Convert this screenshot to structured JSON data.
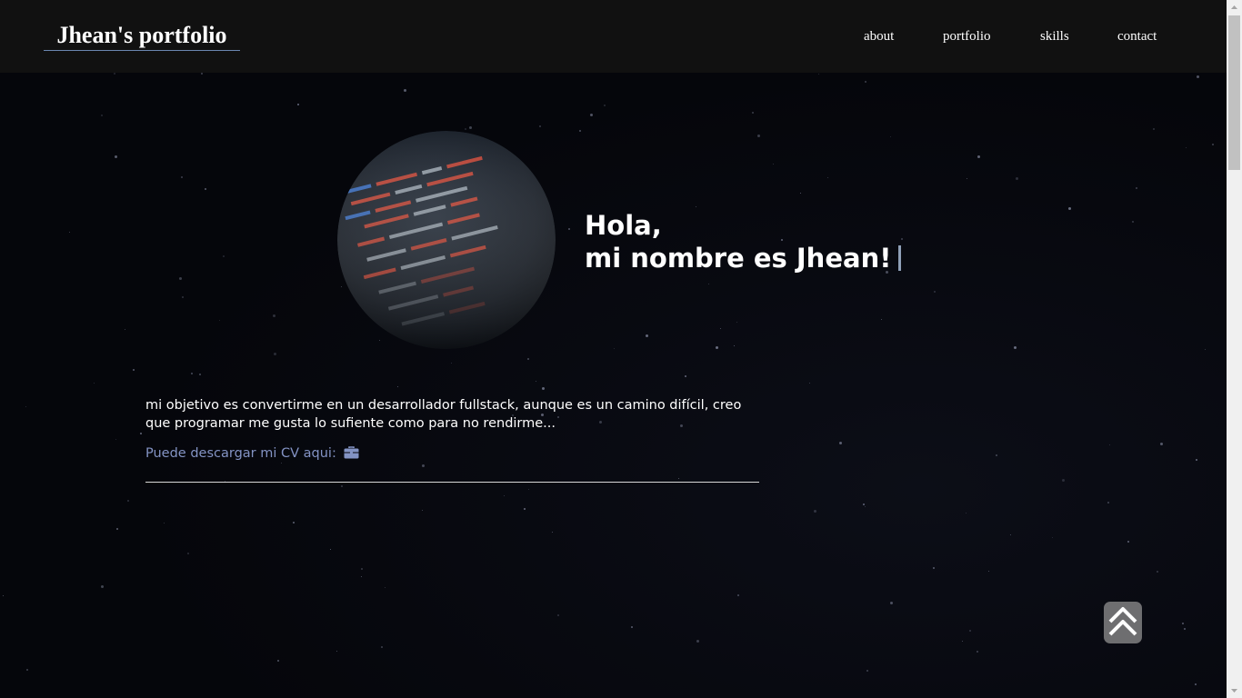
{
  "navbar": {
    "brand": "Jhean's portfolio",
    "links": [
      {
        "label": "about"
      },
      {
        "label": "portfolio"
      },
      {
        "label": "skills"
      },
      {
        "label": "contact"
      }
    ]
  },
  "hero": {
    "greeting_line1": "Hola,",
    "greeting_line2": "mi nombre es Jhean!",
    "avatar_icon": "code-screen-image"
  },
  "about": {
    "objective": "mi objetivo es convertirme en un desarrollador fullstack, aunque es un camino difícil, creo que programar me gusta lo sufiente como para no rendirme...",
    "cv_label": "Puede descargar mi CV aqui:",
    "cv_icon": "briefcase-icon"
  },
  "back_to_top_icon": "double-chevron-up-icon",
  "colors": {
    "navbar_bg": "#111111",
    "page_bg": "#05060b",
    "cv_link": "#8393c4",
    "brand_underline": "#6a86b0"
  }
}
